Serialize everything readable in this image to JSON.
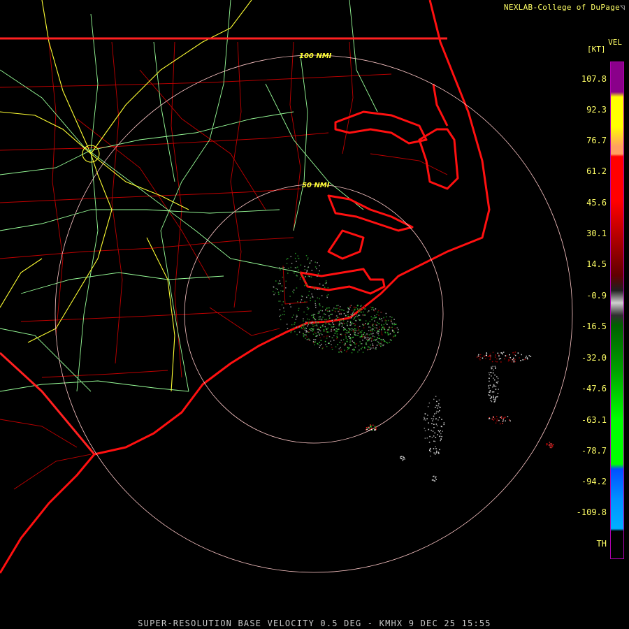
{
  "header": {
    "credit": "NEXLAB-College of DuPage"
  },
  "legend": {
    "product": "VEL",
    "unit": "[KT]",
    "ticks": [
      "107.8",
      "92.3",
      "76.7",
      "61.2",
      "45.6",
      "30.1",
      "14.5",
      "-0.9",
      "-16.5",
      "-32.0",
      "-47.6",
      "-63.1",
      "-78.7",
      "-94.2",
      "-109.8",
      "TH"
    ],
    "colors": {
      "purple": "#8a008a",
      "yellow": "#ffff00",
      "orange": "#ffa060",
      "red": "#ff0000",
      "darkred": "#600000",
      "gray": "#d0d0d0",
      "darkgreen": "#006000",
      "green": "#00ff00",
      "blue": "#0050ff",
      "cyan": "#00b0ff"
    }
  },
  "map": {
    "ring_labels": [
      "100 NMI",
      "50 NMI"
    ],
    "colors": {
      "state_border": "#ff2020",
      "county_border": "#c00000",
      "coast": "#ff1010",
      "highway": "#ffff33",
      "road": "#99ff99",
      "range_ring": "#ffc8c8"
    }
  },
  "footer": {
    "caption": "SUPER-RESOLUTION BASE VELOCITY 0.5 DEG - KMHX 9 DEC 25 15:55"
  }
}
